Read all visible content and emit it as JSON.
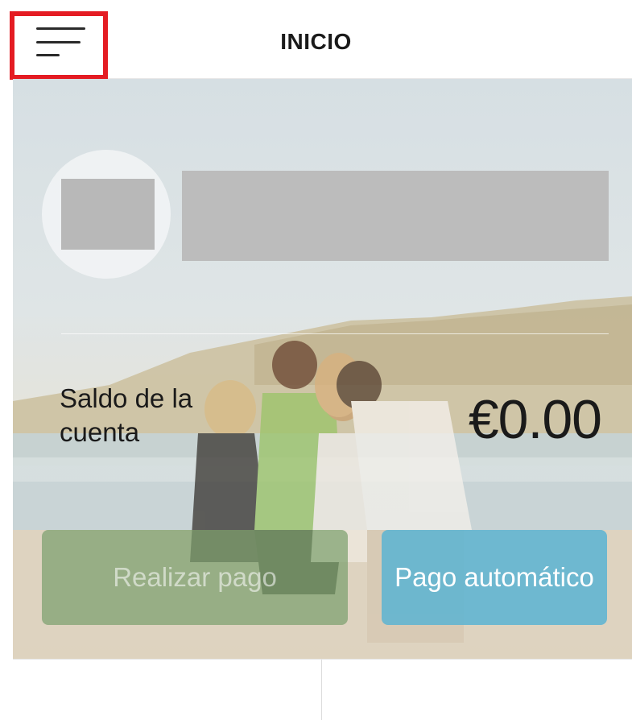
{
  "header": {
    "title": "INICIO",
    "menu_icon": "hamburger-menu-icon",
    "highlight_color": "#e41c23"
  },
  "account": {
    "balance_label": "Saldo de la cuenta",
    "balance_value": "€0.00"
  },
  "actions": {
    "pay_label": "Realizar pago",
    "autopay_label": "Pago automático",
    "autopay_color": "#5fb4d2",
    "pay_color": "#7ca06e"
  },
  "hero": {
    "image": "beach-family-photo"
  }
}
